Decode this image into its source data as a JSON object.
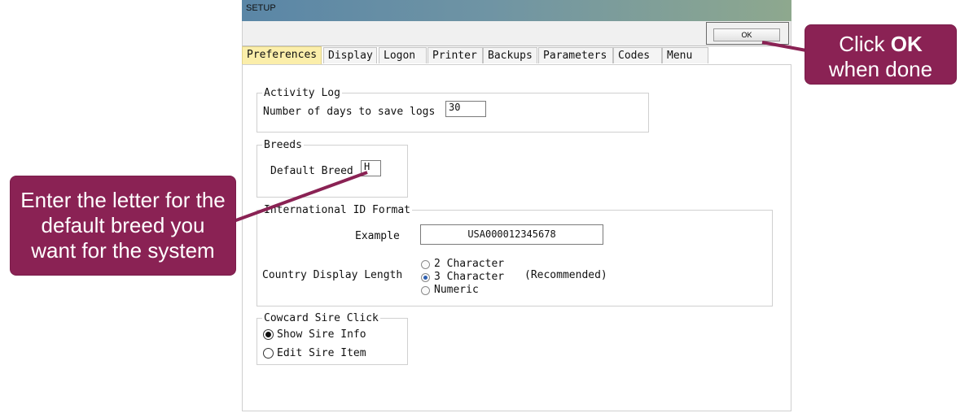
{
  "window": {
    "title": "SETUP"
  },
  "toolbar": {
    "ok_label": "OK"
  },
  "tabs": [
    {
      "label": "Preferences",
      "active": true
    },
    {
      "label": "Display"
    },
    {
      "label": "Logon"
    },
    {
      "label": "Printer"
    },
    {
      "label": "Backups"
    },
    {
      "label": "Parameters"
    },
    {
      "label": "Codes"
    },
    {
      "label": "Menu"
    }
  ],
  "activity_log": {
    "legend": "Activity Log",
    "days_label": "Number of days to save logs",
    "days_value": "30"
  },
  "breeds": {
    "legend": "Breeds",
    "default_label": "Default Breed",
    "default_value": "H"
  },
  "intl_id": {
    "legend": "International ID Format",
    "example_label": "Example",
    "example_value": "USA000012345678",
    "length_label": "Country Display Length",
    "options": [
      "2 Character",
      "3 Character",
      "Numeric"
    ],
    "selected": "3 Character",
    "recommended": "(Recommended)"
  },
  "cowcard": {
    "legend": "Cowcard Sire Click",
    "options": [
      "Show Sire Info",
      "Edit Sire Item"
    ],
    "selected": "Show Sire Info"
  },
  "callouts": {
    "ok": {
      "prefix": "Click ",
      "bold": "OK",
      "line2": "when done"
    },
    "breed": [
      "Enter the letter for the",
      "default breed you",
      "want for the system"
    ]
  },
  "colors": {
    "callout_bg": "#8a2254",
    "active_tab": "#fbeeaa",
    "radio_selected": "#2d5fb0"
  }
}
